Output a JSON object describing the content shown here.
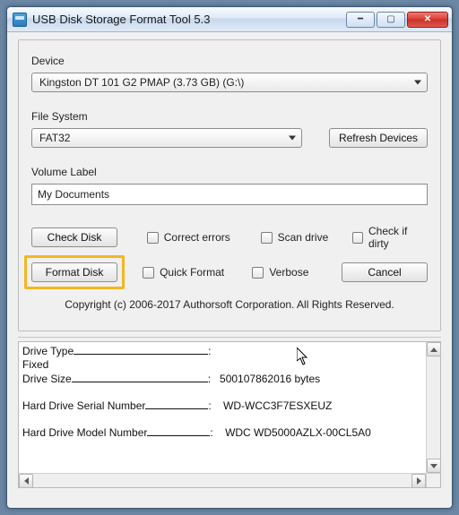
{
  "window": {
    "title": "USB Disk Storage Format Tool 5.3"
  },
  "panel": {
    "device_label": "Device",
    "device_value": "Kingston  DT 101 G2  PMAP (3.73 GB) (G:\\)",
    "fs_label": "File System",
    "fs_value": "FAT32",
    "refresh_label": "Refresh Devices",
    "vol_label": "Volume Label",
    "vol_value": "My Documents",
    "check_disk_btn": "Check Disk",
    "format_disk_btn": "Format Disk",
    "cancel_btn": "Cancel",
    "cb_correct": "Correct errors",
    "cb_scan": "Scan drive",
    "cb_dirty": "Check if dirty",
    "cb_quick": "Quick Format",
    "cb_verbose": "Verbose"
  },
  "copyright": "Copyright (c) 2006-2017 Authorsoft Corporation. All Rights Reserved.",
  "info": {
    "drive_type_label": "Drive Type",
    "drive_type_value": "Fixed",
    "drive_size_label": "Drive Size",
    "drive_size_value": "500107862016 bytes",
    "serial_label": "Hard Drive Serial Number",
    "serial_value": "WD-WCC3F7ESXEUZ",
    "model_label": "Hard Drive Model Number",
    "model_value": "WDC WD5000AZLX-00CL5A0"
  }
}
